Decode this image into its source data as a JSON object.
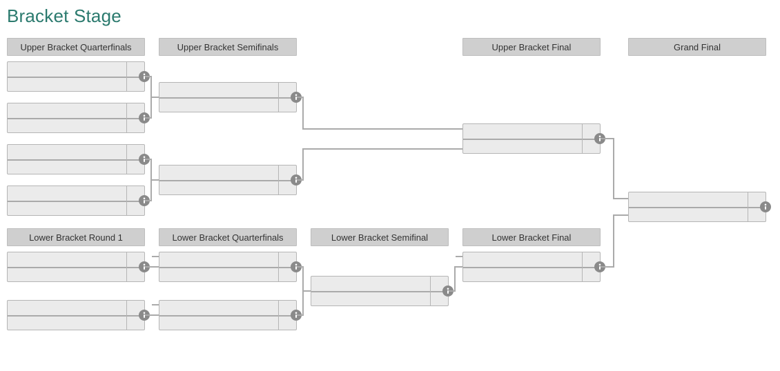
{
  "title": "Bracket Stage",
  "rounds": {
    "upper_qf": "Upper Bracket Quarterfinals",
    "upper_sf": "Upper Bracket Semifinals",
    "upper_f": "Upper Bracket Final",
    "grand_f": "Grand Final",
    "lower_r1": "Lower Bracket Round 1",
    "lower_qf": "Lower Bracket Quarterfinals",
    "lower_sf": "Lower Bracket Semifinal",
    "lower_f": "Lower Bracket Final"
  },
  "icons": {
    "info": "info-icon"
  }
}
